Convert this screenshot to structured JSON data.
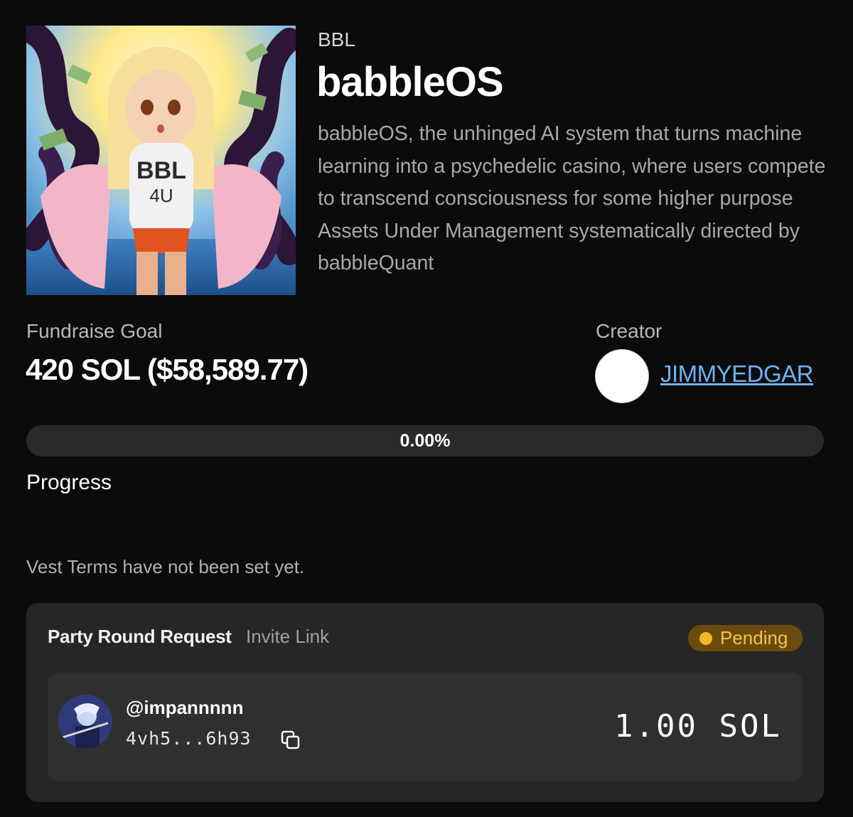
{
  "token": {
    "ticker": "BBL",
    "name": "babbleOS",
    "description": "babbleOS, the unhinged AI system that turns machine learning into a psychedelic casino, where users compete to transcend consciousness for some higher purpose Assets Under Management systematically directed by babbleQuant",
    "image_shirt_text_1": "BBL",
    "image_shirt_text_2": "4U"
  },
  "fundraise": {
    "goal_label": "Fundraise Goal",
    "goal_value": "420 SOL ($58,589.77)"
  },
  "creator": {
    "label": "Creator",
    "name": "JIMMYEDGAR"
  },
  "progress": {
    "percent_text": "0.00%",
    "percent": 0,
    "label": "Progress"
  },
  "vest": {
    "text": "Vest Terms have not been set yet."
  },
  "party_round": {
    "title": "Party Round Request",
    "invite_link": "Invite Link",
    "status": "Pending",
    "request": {
      "handle": "@impannnnn",
      "wallet": "4vh5...6h93",
      "amount": "1.00 SOL"
    }
  },
  "colors": {
    "background": "#0b0b0c",
    "link": "#6cb1f0",
    "pending_bg": "#6b4a0e",
    "pending_dot": "#f3b625",
    "card": "#262626"
  },
  "icons": [
    "copy-icon"
  ]
}
